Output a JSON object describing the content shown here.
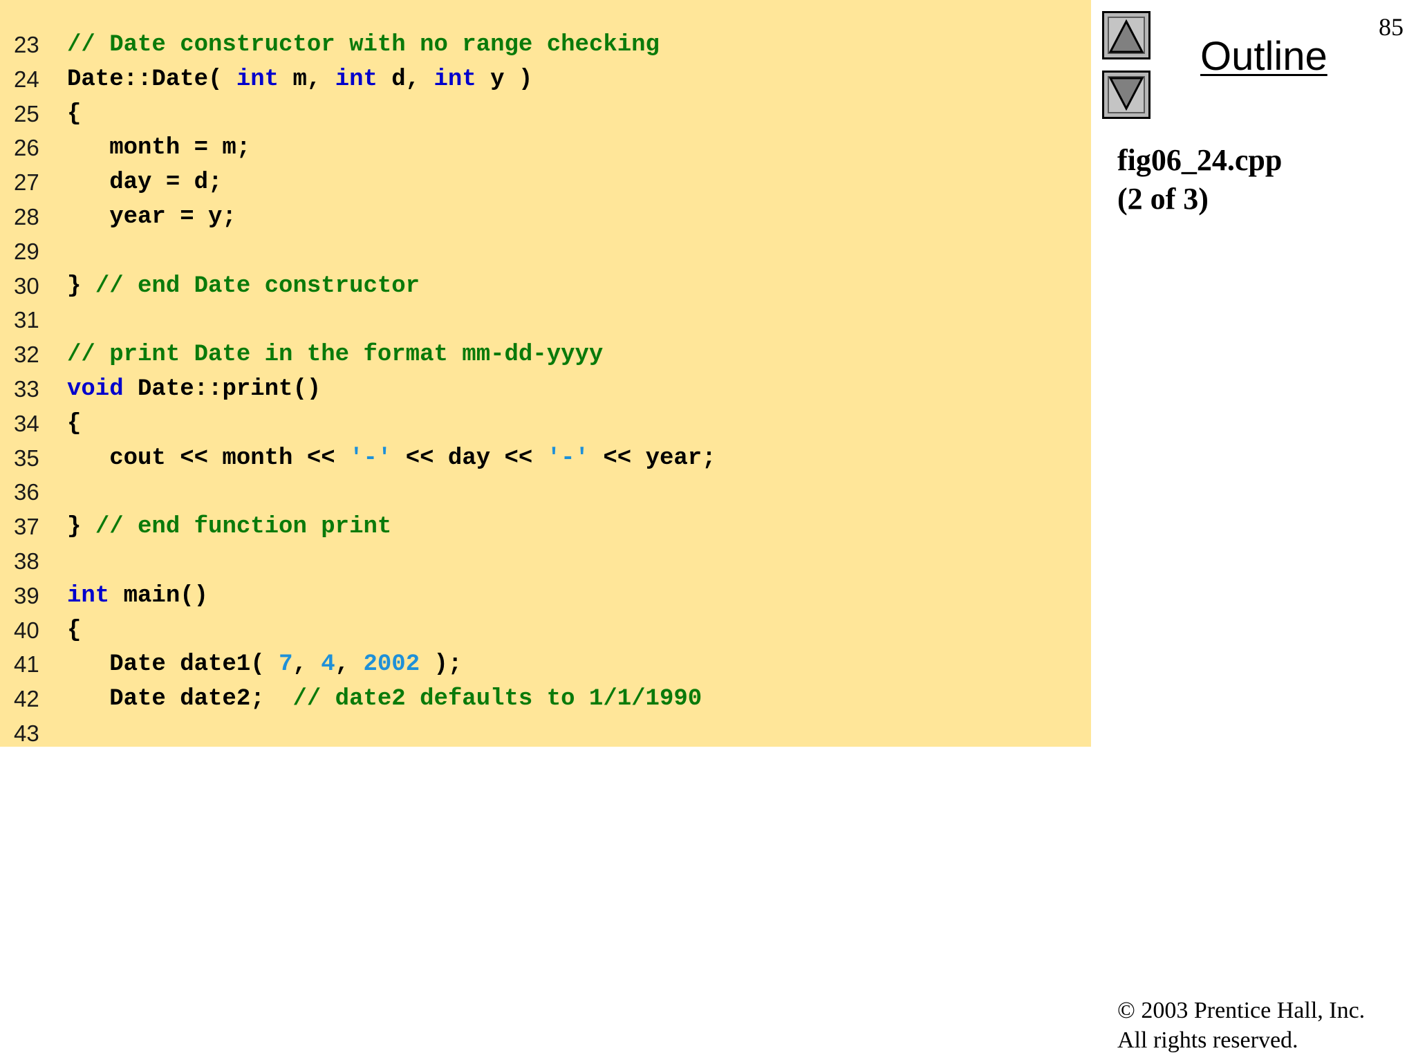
{
  "slide": {
    "page_number": "85",
    "outline_label": "Outline",
    "file_name": "fig06_24.cpp",
    "part_label": "(2 of 3)",
    "copyright_line1": "© 2003 Prentice Hall, Inc.",
    "copyright_line2": "All rights reserved.",
    "icons": {
      "prev": "up-triangle-icon",
      "next": "down-triangle-icon"
    }
  },
  "colors": {
    "code_background": "#FFE699",
    "keyword": "#0000CC",
    "comment": "#0A7A0A",
    "literal": "#1E90D8",
    "plain": "#000000"
  },
  "code": {
    "lines": [
      {
        "num": "23",
        "tokens": [
          {
            "t": "cm",
            "s": "// Date constructor with no range checking"
          }
        ]
      },
      {
        "num": "24",
        "tokens": [
          {
            "t": "pl",
            "s": "Date::Date( "
          },
          {
            "t": "kw",
            "s": "int"
          },
          {
            "t": "pl",
            "s": " m, "
          },
          {
            "t": "kw",
            "s": "int"
          },
          {
            "t": "pl",
            "s": " d, "
          },
          {
            "t": "kw",
            "s": "int"
          },
          {
            "t": "pl",
            "s": " y )"
          }
        ]
      },
      {
        "num": "25",
        "tokens": [
          {
            "t": "pl",
            "s": "{"
          }
        ]
      },
      {
        "num": "26",
        "tokens": [
          {
            "t": "pl",
            "s": "   month = m;"
          }
        ]
      },
      {
        "num": "27",
        "tokens": [
          {
            "t": "pl",
            "s": "   day = d;"
          }
        ]
      },
      {
        "num": "28",
        "tokens": [
          {
            "t": "pl",
            "s": "   year = y;"
          }
        ]
      },
      {
        "num": "29",
        "tokens": []
      },
      {
        "num": "30",
        "tokens": [
          {
            "t": "pl",
            "s": "} "
          },
          {
            "t": "cm",
            "s": "// end Date constructor"
          }
        ]
      },
      {
        "num": "31",
        "tokens": []
      },
      {
        "num": "32",
        "tokens": [
          {
            "t": "cm",
            "s": "// print Date in the format mm-dd-yyyy"
          }
        ]
      },
      {
        "num": "33",
        "tokens": [
          {
            "t": "kw",
            "s": "void"
          },
          {
            "t": "pl",
            "s": " Date::print()"
          }
        ]
      },
      {
        "num": "34",
        "tokens": [
          {
            "t": "pl",
            "s": "{"
          }
        ]
      },
      {
        "num": "35",
        "tokens": [
          {
            "t": "pl",
            "s": "   cout << month << "
          },
          {
            "t": "lit",
            "s": "'-'"
          },
          {
            "t": "pl",
            "s": " << day << "
          },
          {
            "t": "lit",
            "s": "'-'"
          },
          {
            "t": "pl",
            "s": " << year;"
          }
        ]
      },
      {
        "num": "36",
        "tokens": []
      },
      {
        "num": "37",
        "tokens": [
          {
            "t": "pl",
            "s": "} "
          },
          {
            "t": "cm",
            "s": "// end function print"
          }
        ]
      },
      {
        "num": "38",
        "tokens": []
      },
      {
        "num": "39",
        "tokens": [
          {
            "t": "kw",
            "s": "int"
          },
          {
            "t": "pl",
            "s": " main()"
          }
        ]
      },
      {
        "num": "40",
        "tokens": [
          {
            "t": "pl",
            "s": "{"
          }
        ]
      },
      {
        "num": "41",
        "tokens": [
          {
            "t": "pl",
            "s": "   Date date1( "
          },
          {
            "t": "lit",
            "s": "7"
          },
          {
            "t": "pl",
            "s": ", "
          },
          {
            "t": "lit",
            "s": "4"
          },
          {
            "t": "pl",
            "s": ", "
          },
          {
            "t": "lit",
            "s": "2002"
          },
          {
            "t": "pl",
            "s": " );"
          }
        ]
      },
      {
        "num": "42",
        "tokens": [
          {
            "t": "pl",
            "s": "   Date date2;  "
          },
          {
            "t": "cm",
            "s": "// date2 defaults to 1/1/1990"
          }
        ]
      },
      {
        "num": "43",
        "tokens": []
      }
    ]
  }
}
